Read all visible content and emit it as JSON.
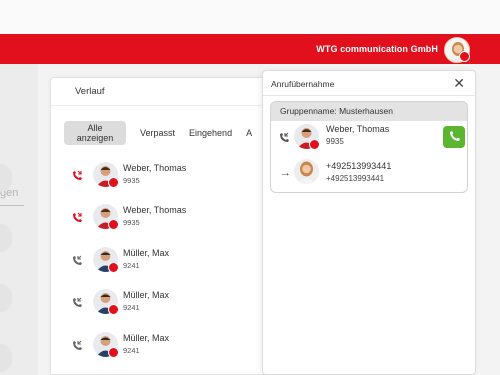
{
  "header": {
    "company": "WTG communication GmbH"
  },
  "sidebar": {
    "search_placeholder": "gen"
  },
  "history": {
    "title": "Verlauf",
    "tabs": [
      "Alle anzeigen",
      "Verpasst",
      "Eingehend",
      "A"
    ],
    "entries": [
      {
        "name": "Weber, Thomas",
        "ext": "9935",
        "type": "missed"
      },
      {
        "name": "Weber, Thomas",
        "ext": "9935",
        "type": "missed"
      },
      {
        "name": "Müller, Max",
        "ext": "9241",
        "type": "normal"
      },
      {
        "name": "Müller, Max",
        "ext": "9241",
        "type": "normal"
      },
      {
        "name": "Müller, Max",
        "ext": "9241",
        "type": "normal"
      }
    ]
  },
  "pickup": {
    "title": "Anrufübernahme",
    "group": "Gruppenname: Musterhausen",
    "caller": {
      "name": "Weber, Thomas",
      "ext": "9935"
    },
    "target": {
      "line1": "+492513993441",
      "line2": "+492513993441"
    }
  },
  "colors": {
    "brand": "#e2101c",
    "accept": "#5cb531"
  }
}
